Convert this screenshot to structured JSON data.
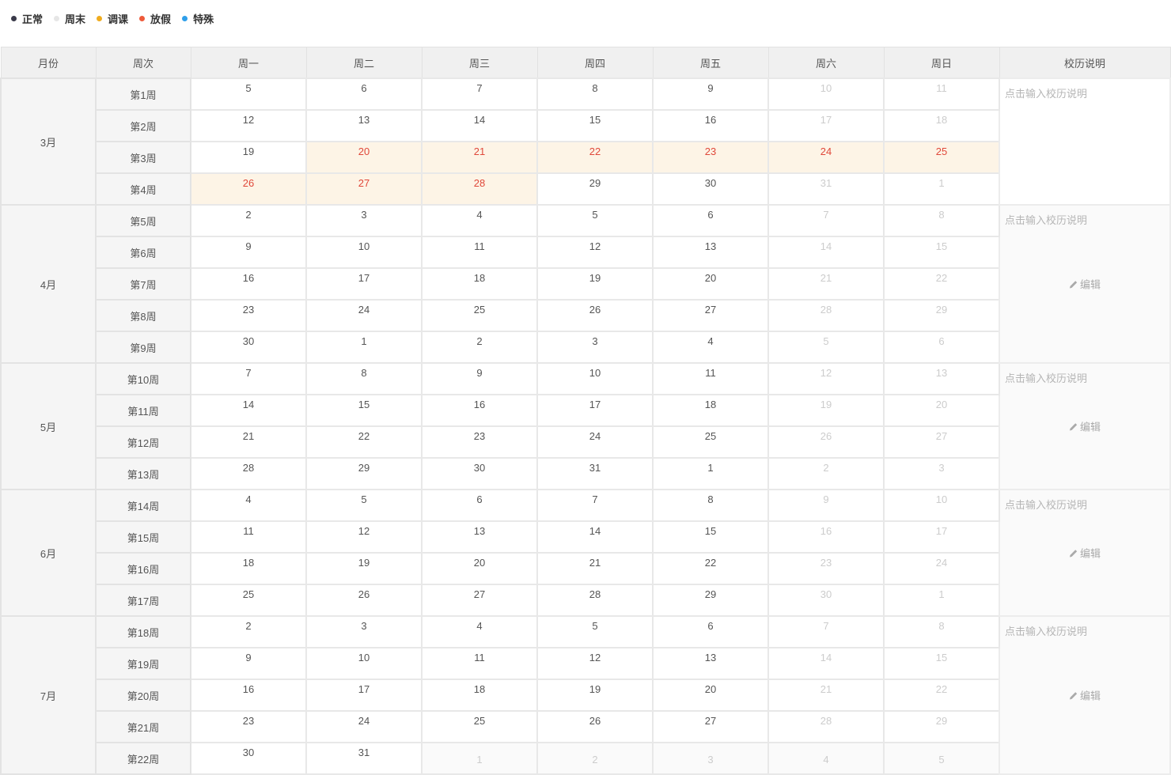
{
  "legend": [
    {
      "label": "正常",
      "color": "#3a3a4a"
    },
    {
      "label": "周末",
      "color": "#e6e6e6"
    },
    {
      "label": "调课",
      "color": "#f0ac1e"
    },
    {
      "label": "放假",
      "color": "#ee5a3a"
    },
    {
      "label": "特殊",
      "color": "#2f9fea"
    }
  ],
  "headers": [
    "月份",
    "周次",
    "周一",
    "周二",
    "周三",
    "周四",
    "周五",
    "周六",
    "周日",
    "校历说明"
  ],
  "note_placeholder": "点击输入校历说明",
  "edit_label": "编辑",
  "months": [
    {
      "label": "3月",
      "show_edit": false,
      "weeks": [
        {
          "label": "第1周",
          "days": [
            [
              "5",
              "n"
            ],
            [
              "6",
              "n"
            ],
            [
              "7",
              "n"
            ],
            [
              "8",
              "n"
            ],
            [
              "9",
              "n"
            ],
            [
              "10",
              "w"
            ],
            [
              "11",
              "w"
            ]
          ]
        },
        {
          "label": "第2周",
          "days": [
            [
              "12",
              "n"
            ],
            [
              "13",
              "n"
            ],
            [
              "14",
              "n"
            ],
            [
              "15",
              "n"
            ],
            [
              "16",
              "n"
            ],
            [
              "17",
              "w"
            ],
            [
              "18",
              "w"
            ]
          ]
        },
        {
          "label": "第3周",
          "days": [
            [
              "19",
              "n"
            ],
            [
              "20",
              "h"
            ],
            [
              "21",
              "h"
            ],
            [
              "22",
              "h"
            ],
            [
              "23",
              "h"
            ],
            [
              "24",
              "h"
            ],
            [
              "25",
              "h"
            ]
          ]
        },
        {
          "label": "第4周",
          "days": [
            [
              "26",
              "h"
            ],
            [
              "27",
              "h"
            ],
            [
              "28",
              "h"
            ],
            [
              "29",
              "n"
            ],
            [
              "30",
              "n"
            ],
            [
              "31",
              "w"
            ],
            [
              "1",
              "w"
            ]
          ]
        }
      ]
    },
    {
      "label": "4月",
      "show_edit": true,
      "weeks": [
        {
          "label": "第5周",
          "days": [
            [
              "2",
              "n"
            ],
            [
              "3",
              "n"
            ],
            [
              "4",
              "n"
            ],
            [
              "5",
              "n"
            ],
            [
              "6",
              "n"
            ],
            [
              "7",
              "w"
            ],
            [
              "8",
              "w"
            ]
          ]
        },
        {
          "label": "第6周",
          "days": [
            [
              "9",
              "n"
            ],
            [
              "10",
              "n"
            ],
            [
              "11",
              "n"
            ],
            [
              "12",
              "n"
            ],
            [
              "13",
              "n"
            ],
            [
              "14",
              "w"
            ],
            [
              "15",
              "w"
            ]
          ]
        },
        {
          "label": "第7周",
          "days": [
            [
              "16",
              "n"
            ],
            [
              "17",
              "n"
            ],
            [
              "18",
              "n"
            ],
            [
              "19",
              "n"
            ],
            [
              "20",
              "n"
            ],
            [
              "21",
              "w"
            ],
            [
              "22",
              "w"
            ]
          ]
        },
        {
          "label": "第8周",
          "days": [
            [
              "23",
              "n"
            ],
            [
              "24",
              "n"
            ],
            [
              "25",
              "n"
            ],
            [
              "26",
              "n"
            ],
            [
              "27",
              "n"
            ],
            [
              "28",
              "w"
            ],
            [
              "29",
              "w"
            ]
          ]
        },
        {
          "label": "第9周",
          "days": [
            [
              "30",
              "n"
            ],
            [
              "1",
              "n"
            ],
            [
              "2",
              "n"
            ],
            [
              "3",
              "n"
            ],
            [
              "4",
              "n"
            ],
            [
              "5",
              "w"
            ],
            [
              "6",
              "w"
            ]
          ]
        }
      ]
    },
    {
      "label": "5月",
      "show_edit": true,
      "weeks": [
        {
          "label": "第10周",
          "days": [
            [
              "7",
              "n"
            ],
            [
              "8",
              "n"
            ],
            [
              "9",
              "n"
            ],
            [
              "10",
              "n"
            ],
            [
              "11",
              "n"
            ],
            [
              "12",
              "w"
            ],
            [
              "13",
              "w"
            ]
          ]
        },
        {
          "label": "第11周",
          "days": [
            [
              "14",
              "n"
            ],
            [
              "15",
              "n"
            ],
            [
              "16",
              "n"
            ],
            [
              "17",
              "n"
            ],
            [
              "18",
              "n"
            ],
            [
              "19",
              "w"
            ],
            [
              "20",
              "w"
            ]
          ]
        },
        {
          "label": "第12周",
          "days": [
            [
              "21",
              "n"
            ],
            [
              "22",
              "n"
            ],
            [
              "23",
              "n"
            ],
            [
              "24",
              "n"
            ],
            [
              "25",
              "n"
            ],
            [
              "26",
              "w"
            ],
            [
              "27",
              "w"
            ]
          ]
        },
        {
          "label": "第13周",
          "days": [
            [
              "28",
              "n"
            ],
            [
              "29",
              "n"
            ],
            [
              "30",
              "n"
            ],
            [
              "31",
              "n"
            ],
            [
              "1",
              "n"
            ],
            [
              "2",
              "w"
            ],
            [
              "3",
              "w"
            ]
          ]
        }
      ]
    },
    {
      "label": "6月",
      "show_edit": true,
      "weeks": [
        {
          "label": "第14周",
          "days": [
            [
              "4",
              "n"
            ],
            [
              "5",
              "n"
            ],
            [
              "6",
              "n"
            ],
            [
              "7",
              "n"
            ],
            [
              "8",
              "n"
            ],
            [
              "9",
              "w"
            ],
            [
              "10",
              "w"
            ]
          ]
        },
        {
          "label": "第15周",
          "days": [
            [
              "11",
              "n"
            ],
            [
              "12",
              "n"
            ],
            [
              "13",
              "n"
            ],
            [
              "14",
              "n"
            ],
            [
              "15",
              "n"
            ],
            [
              "16",
              "w"
            ],
            [
              "17",
              "w"
            ]
          ]
        },
        {
          "label": "第16周",
          "days": [
            [
              "18",
              "n"
            ],
            [
              "19",
              "n"
            ],
            [
              "20",
              "n"
            ],
            [
              "21",
              "n"
            ],
            [
              "22",
              "n"
            ],
            [
              "23",
              "w"
            ],
            [
              "24",
              "w"
            ]
          ]
        },
        {
          "label": "第17周",
          "days": [
            [
              "25",
              "n"
            ],
            [
              "26",
              "n"
            ],
            [
              "27",
              "n"
            ],
            [
              "28",
              "n"
            ],
            [
              "29",
              "n"
            ],
            [
              "30",
              "w"
            ],
            [
              "1",
              "w"
            ]
          ]
        }
      ]
    },
    {
      "label": "7月",
      "show_edit": true,
      "weeks": [
        {
          "label": "第18周",
          "days": [
            [
              "2",
              "n"
            ],
            [
              "3",
              "n"
            ],
            [
              "4",
              "n"
            ],
            [
              "5",
              "n"
            ],
            [
              "6",
              "n"
            ],
            [
              "7",
              "w"
            ],
            [
              "8",
              "w"
            ]
          ]
        },
        {
          "label": "第19周",
          "days": [
            [
              "9",
              "n"
            ],
            [
              "10",
              "n"
            ],
            [
              "11",
              "n"
            ],
            [
              "12",
              "n"
            ],
            [
              "13",
              "n"
            ],
            [
              "14",
              "w"
            ],
            [
              "15",
              "w"
            ]
          ]
        },
        {
          "label": "第20周",
          "days": [
            [
              "16",
              "n"
            ],
            [
              "17",
              "n"
            ],
            [
              "18",
              "n"
            ],
            [
              "19",
              "n"
            ],
            [
              "20",
              "n"
            ],
            [
              "21",
              "w"
            ],
            [
              "22",
              "w"
            ]
          ]
        },
        {
          "label": "第21周",
          "days": [
            [
              "23",
              "n"
            ],
            [
              "24",
              "n"
            ],
            [
              "25",
              "n"
            ],
            [
              "26",
              "n"
            ],
            [
              "27",
              "n"
            ],
            [
              "28",
              "w"
            ],
            [
              "29",
              "w"
            ]
          ]
        },
        {
          "label": "第22周",
          "days": [
            [
              "30",
              "n"
            ],
            [
              "31",
              "n"
            ],
            [
              "1",
              "o"
            ],
            [
              "2",
              "o"
            ],
            [
              "3",
              "o"
            ],
            [
              "4",
              "o"
            ],
            [
              "5",
              "o"
            ]
          ]
        }
      ]
    }
  ]
}
